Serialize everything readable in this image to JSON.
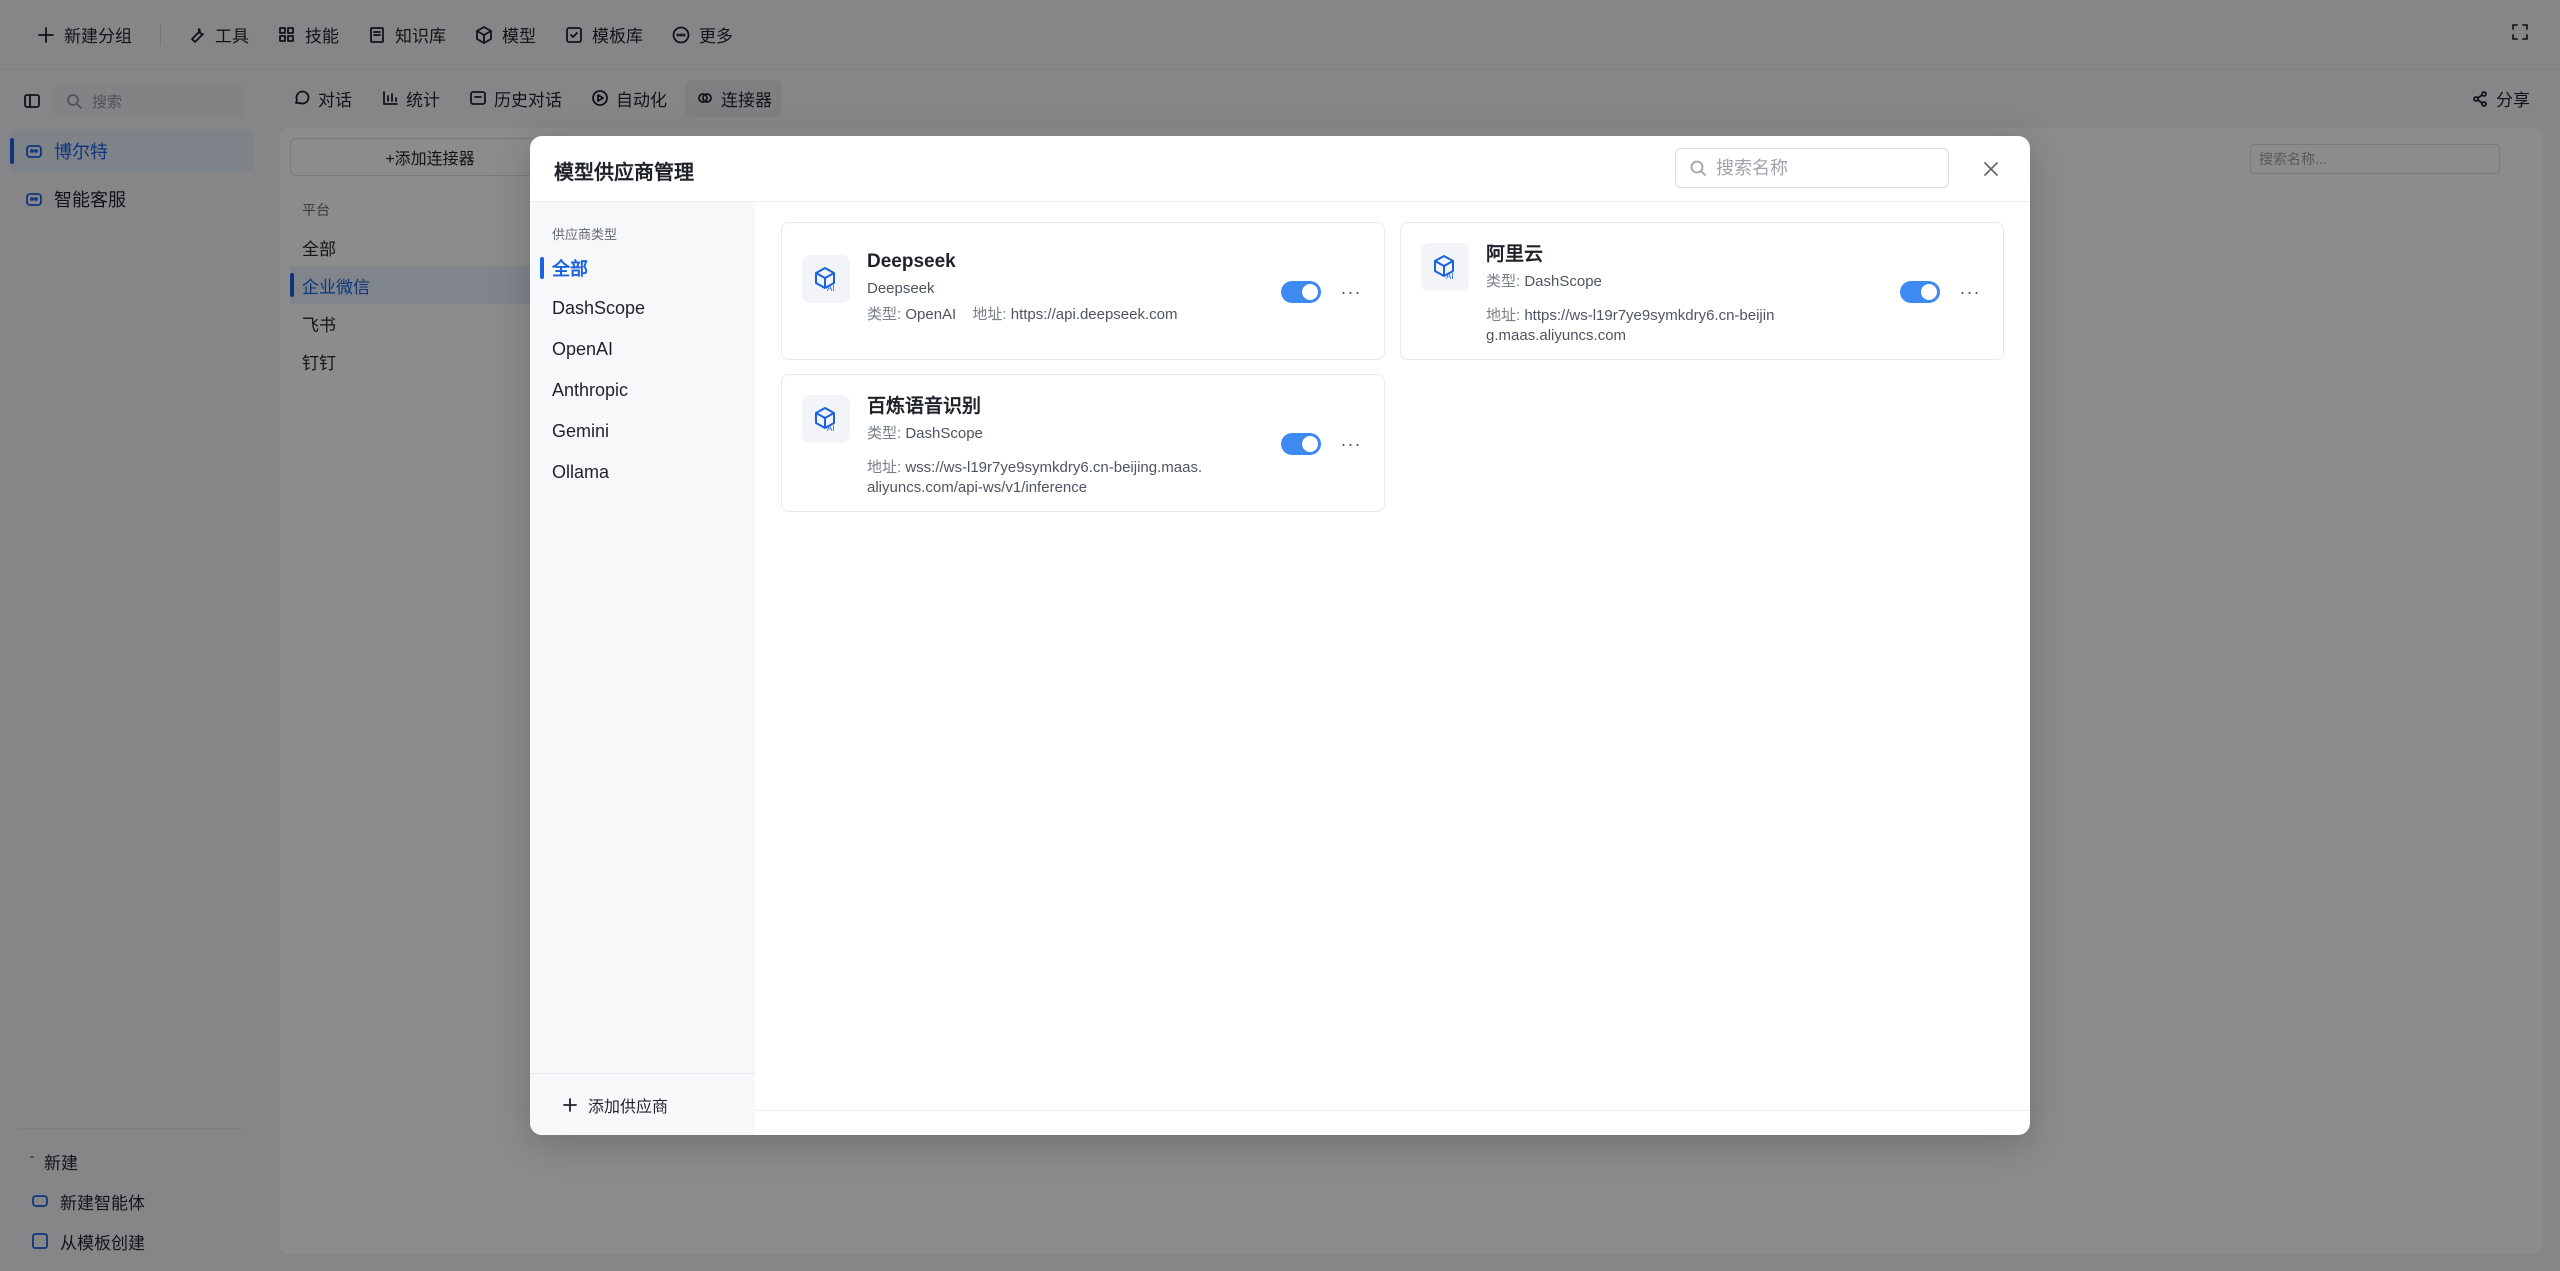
{
  "topbar": {
    "items": [
      {
        "label": "新建分组",
        "icon": "plus-icon"
      },
      {
        "label": "工具",
        "icon": "wrench-icon"
      },
      {
        "label": "技能",
        "icon": "grid-icon"
      },
      {
        "label": "知识库",
        "icon": "book-icon"
      },
      {
        "label": "模型",
        "icon": "cube-icon"
      },
      {
        "label": "模板库",
        "icon": "template-icon"
      },
      {
        "label": "更多",
        "icon": "ellipsis-circle-icon"
      }
    ]
  },
  "sidebar": {
    "search_placeholder": "搜索",
    "items": [
      {
        "label": "博尔特"
      },
      {
        "label": "智能客服"
      }
    ],
    "bottom": {
      "new_label": "新建",
      "new_agent": "新建智能体",
      "from_template": "从模板创建"
    }
  },
  "subbar": {
    "tabs": [
      {
        "label": "对话"
      },
      {
        "label": "统计"
      },
      {
        "label": "历史对话"
      },
      {
        "label": "自动化"
      },
      {
        "label": "连接器"
      }
    ],
    "share": "分享"
  },
  "connectors": {
    "add_label": "+添加连接器",
    "category": "平台",
    "items": [
      "全部",
      "企业微信",
      "飞书",
      "钉钉"
    ],
    "search_placeholder": "搜索名称..."
  },
  "modal": {
    "title": "模型供应商管理",
    "search_placeholder": "搜索名称",
    "category_title": "供应商类型",
    "categories": [
      "全部",
      "DashScope",
      "OpenAI",
      "Anthropic",
      "Gemini",
      "Ollama"
    ],
    "add_provider": "添加供应商",
    "type_label": "类型:",
    "address_label": "地址:",
    "providers": [
      {
        "name": "Deepseek",
        "subtitle": "Deepseek",
        "type": "OpenAI",
        "address": "https://api.deepseek.com",
        "enabled": true
      },
      {
        "name": "阿里云",
        "type": "DashScope",
        "address": "https://ws-l19r7ye9symkdry6.cn-beijing.maas.aliyuncs.com",
        "enabled": true
      },
      {
        "name": "百炼语音识别",
        "type": "DashScope",
        "address": "wss://ws-l19r7ye9symkdry6.cn-beijing.maas.aliyuncs.com/api-ws/v1/inference",
        "enabled": true
      }
    ]
  },
  "colors": {
    "accent": "#1a62e0",
    "toggle_on": "#3d8bf2"
  }
}
